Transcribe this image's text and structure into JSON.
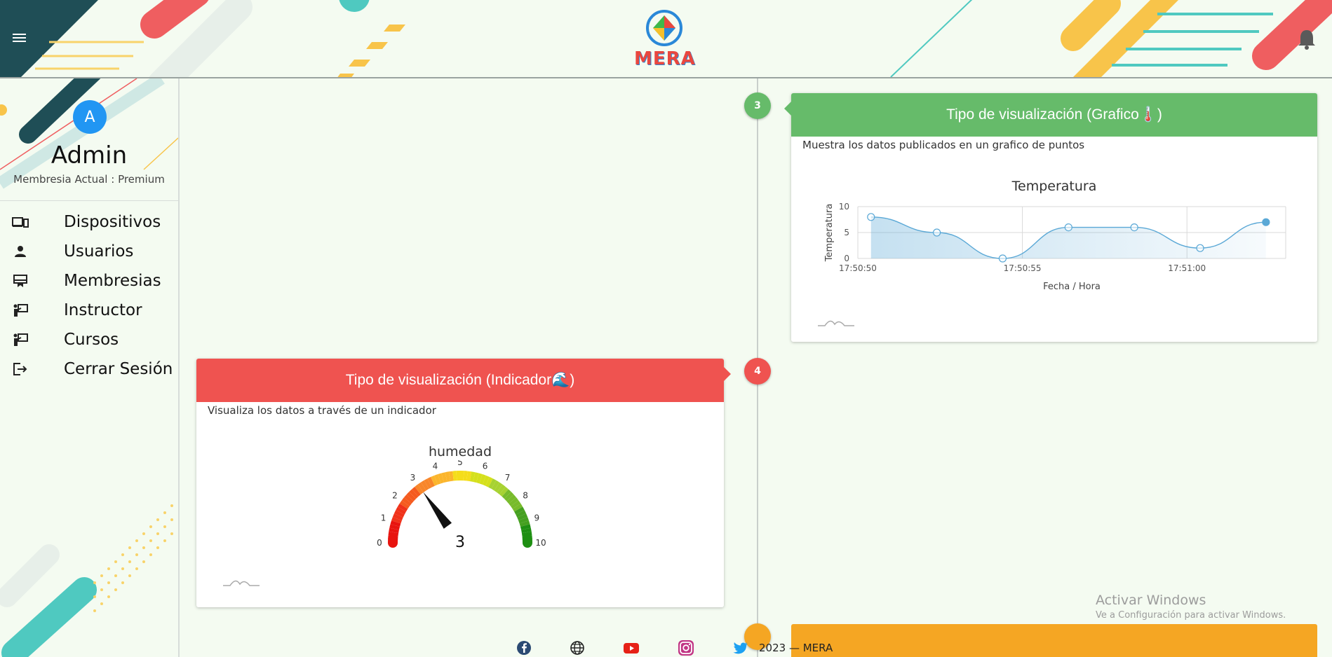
{
  "app": {
    "logo_text": "MERA"
  },
  "header": {
    "menu_icon": "hamburger-icon",
    "notification_icon": "bell-icon"
  },
  "user": {
    "avatar_letter": "A",
    "name": "Admin",
    "membership": "Membresia Actual : Premium"
  },
  "sidebar": {
    "items": [
      {
        "label": "Dispositivos",
        "icon": "devices-icon"
      },
      {
        "label": "Usuarios",
        "icon": "person-icon"
      },
      {
        "label": "Membresias",
        "icon": "card-membership-icon"
      },
      {
        "label": "Instructor",
        "icon": "instructor-icon"
      },
      {
        "label": "Cursos",
        "icon": "instructor-icon"
      },
      {
        "label": "Cerrar Sesión",
        "icon": "logout-icon"
      }
    ]
  },
  "timeline": {
    "card3": {
      "number": "3",
      "title": "Tipo de visualización (Grafico🌡️)",
      "description": "Muestra los datos publicados en un grafico de puntos",
      "color": "#66bb6a"
    },
    "card4": {
      "number": "4",
      "title": "Tipo de visualización (Indicador🌊)",
      "description": "Visualiza los datos a través de un indicador",
      "color": "#ef5350"
    },
    "card5": {
      "color": "#f5a623"
    }
  },
  "chart_data": [
    {
      "type": "line",
      "title": "Temperatura",
      "xlabel": "Fecha / Hora",
      "ylabel": "Temperatura",
      "x": [
        "17:50:50.4",
        "17:50:52.4",
        "17:50:54.4",
        "17:50:56.4",
        "17:50:58.4",
        "17:51:00.4",
        "17:51:02.4"
      ],
      "x_seconds": [
        50.4,
        52.4,
        54.4,
        56.4,
        58.4,
        60.4,
        62.4
      ],
      "values": [
        8,
        5,
        0,
        6,
        6,
        2,
        7
      ],
      "yticks": [
        "0",
        "5",
        "10"
      ],
      "xticks": [
        "17:50:50",
        "17:50:55",
        "17:51:00"
      ],
      "xticks_seconds": [
        50,
        55,
        60
      ],
      "xlim_seconds": [
        50,
        63
      ],
      "ylim": [
        0,
        10
      ],
      "grid": true,
      "series_color": "#5aa8d6"
    },
    {
      "type": "gauge",
      "title": "humedad",
      "value": 3,
      "value_label": "3",
      "min": 0,
      "max": 10,
      "ticks": [
        "0",
        "1",
        "2",
        "3",
        "4",
        "5",
        "6",
        "7",
        "8",
        "9",
        "10"
      ]
    }
  ],
  "footer": {
    "icons": [
      "facebook-icon",
      "globe-icon",
      "youtube-icon",
      "instagram-icon",
      "twitter-icon"
    ],
    "text": "2023 — MERA"
  },
  "watermark": {
    "line1": "Activar Windows",
    "line2": "Ve a Configuración para activar Windows."
  }
}
